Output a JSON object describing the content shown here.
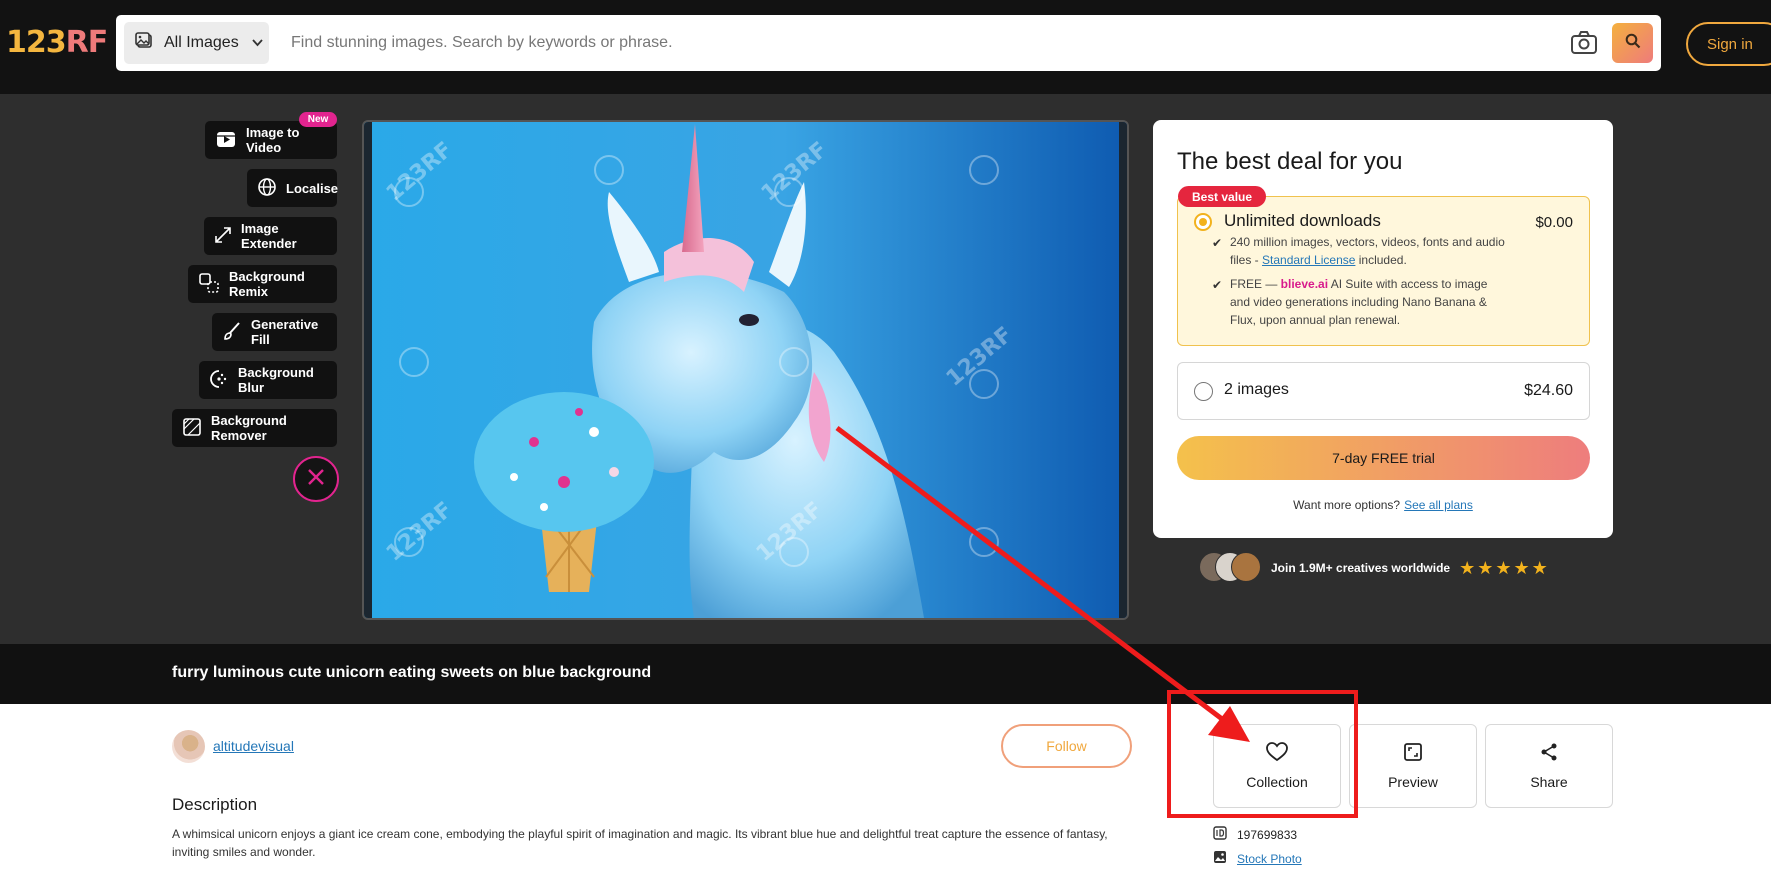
{
  "header": {
    "logo_text_a": "123",
    "logo_text_b": "RF",
    "type_select": "All Images",
    "search_placeholder": "Find stunning images. Search by keywords or phrase.",
    "signin_label": "Sign in"
  },
  "tools": {
    "new_badge": "New",
    "items": [
      {
        "label": "Image to Video",
        "icon": "video-icon"
      },
      {
        "label": "Localise",
        "icon": "globe-icon"
      },
      {
        "label": "Image Extender",
        "icon": "expand-icon"
      },
      {
        "label": "Background Remix",
        "icon": "remix-icon"
      },
      {
        "label": "Generative Fill",
        "icon": "brush-icon"
      },
      {
        "label": "Background Blur",
        "icon": "blur-icon"
      },
      {
        "label": "Background Remover",
        "icon": "eraser-icon"
      }
    ]
  },
  "deal": {
    "title": "The best deal for you",
    "best_value": "Best value",
    "option1": {
      "label": "Unlimited downloads",
      "price": "$0.00",
      "feature1_a": "240 million images, vectors, videos, fonts and audio files - ",
      "feature1_link": "Standard License",
      "feature1_b": " included.",
      "feature2_a": "FREE — ",
      "feature2_brand": "blieve.ai",
      "feature2_b": " AI Suite with access to image and video generations including Nano Banana & Flux, upon annual plan renewal."
    },
    "option2": {
      "label": "2 images",
      "price": "$24.60"
    },
    "trial_label": "7-day FREE trial",
    "more_text": "Want more options?",
    "more_link": "See all plans"
  },
  "social": {
    "text": "Join 1.9M+ creatives worldwide",
    "stars": "★★★★★",
    "rating": 5
  },
  "image": {
    "title": "furry luminous cute unicorn eating sweets on blue background",
    "watermark": "123RF"
  },
  "author": {
    "name": "altitudevisual",
    "follow_label": "Follow"
  },
  "description": {
    "heading": "Description",
    "text": "A whimsical unicorn enjoys a giant ice cream cone, embodying the playful spirit of imagination and magic. Its vibrant blue hue and delightful treat capture the essence of fantasy, inviting smiles and wonder."
  },
  "actions": {
    "collection": "Collection",
    "preview": "Preview",
    "share": "Share"
  },
  "meta": {
    "id": "197699833",
    "type_link": "Stock Photo"
  },
  "colors": {
    "accent": "#f0a83e",
    "brand_pink": "#e2248f",
    "annotation_red": "#ee1c1c"
  }
}
